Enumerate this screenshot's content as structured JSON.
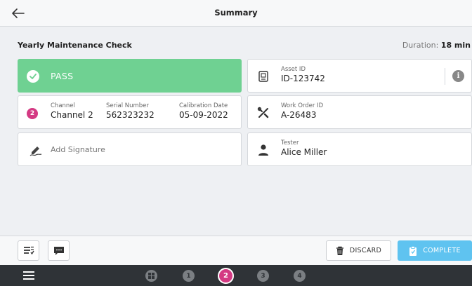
{
  "header": {
    "title": "Summary",
    "back_icon": "arrow-left-icon"
  },
  "check": {
    "name": "Yearly Maintenance Check",
    "duration_label": "Duration:",
    "duration_value": "18 min"
  },
  "result": {
    "label": "PASS",
    "color": "#6fd192"
  },
  "channel": {
    "badge": "2",
    "badge_color": "#d43a83",
    "channel_label": "Channel",
    "channel_value": "Channel 2",
    "serial_label": "Serial Number",
    "serial_value": "562323232",
    "calibration_label": "Calibration Date",
    "calibration_value": "05-09-2022"
  },
  "signature": {
    "label": "Add Signature"
  },
  "asset": {
    "label": "Asset ID",
    "value": "ID-123742",
    "info_glyph": "i"
  },
  "work_order": {
    "label": "Work Order ID",
    "value": "A-26483"
  },
  "tester": {
    "label": "Tester",
    "value": "Alice Miller"
  },
  "actions": {
    "discard_label": "DISCARD",
    "complete_label": "COMPLETE",
    "complete_color": "#5fc3f0"
  },
  "nav": {
    "steps": [
      "1",
      "2",
      "3",
      "4"
    ],
    "active_step": "2",
    "active_color": "#d43a83"
  }
}
